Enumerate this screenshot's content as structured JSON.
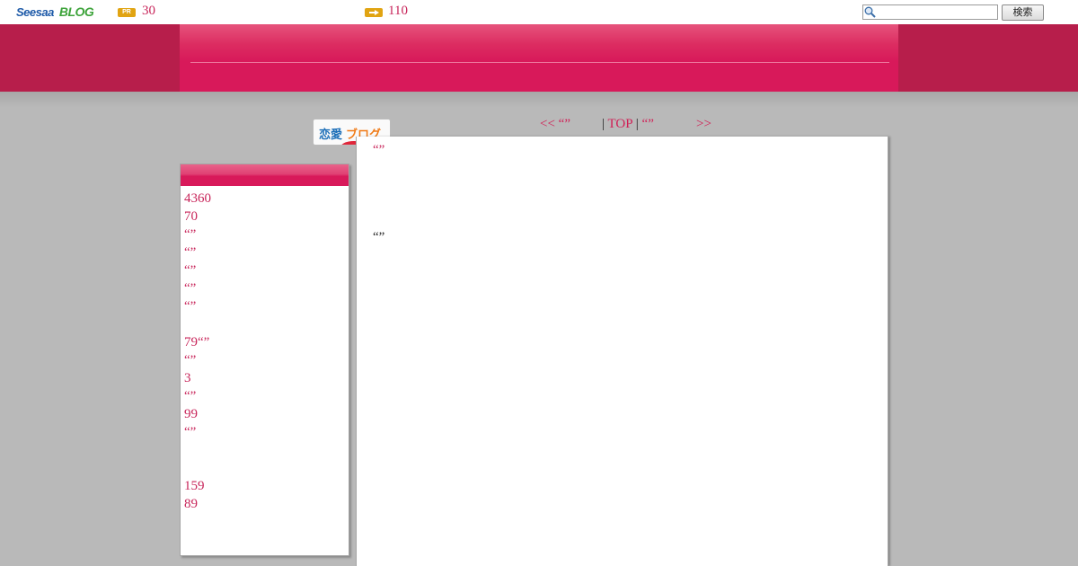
{
  "topbar": {
    "brand_left": "Seesaa",
    "brand_right": "BLOG",
    "pr_badge": "PR",
    "pr_count": "30",
    "arrow_count": "110",
    "search_placeholder": "",
    "search_button": "検索",
    "search_icon": "magnifier-icon",
    "arrow_icon": "arrow-right-icon"
  },
  "badge": {
    "part1": "恋愛",
    "part2": "ブログ"
  },
  "nav": {
    "prev_label": "<< “”",
    "separator1": "|",
    "top_label": "TOP",
    "separator2": "|",
    "mid_label": "“”",
    "next_label": ">>"
  },
  "sidebar": {
    "items": [
      "4360",
      "70",
      "“”",
      "“”",
      "“”",
      "“”",
      "“”",
      "",
      "79“”",
      "“”",
      "3",
      "“”",
      "99",
      "“”",
      "",
      "",
      "159",
      "89"
    ]
  },
  "main": {
    "title": "“”",
    "body": "“”"
  },
  "colors": {
    "accent": "#d8195a",
    "header_dark": "#b71e4b",
    "link": "#c8255a",
    "background": "#b9b9b9"
  }
}
